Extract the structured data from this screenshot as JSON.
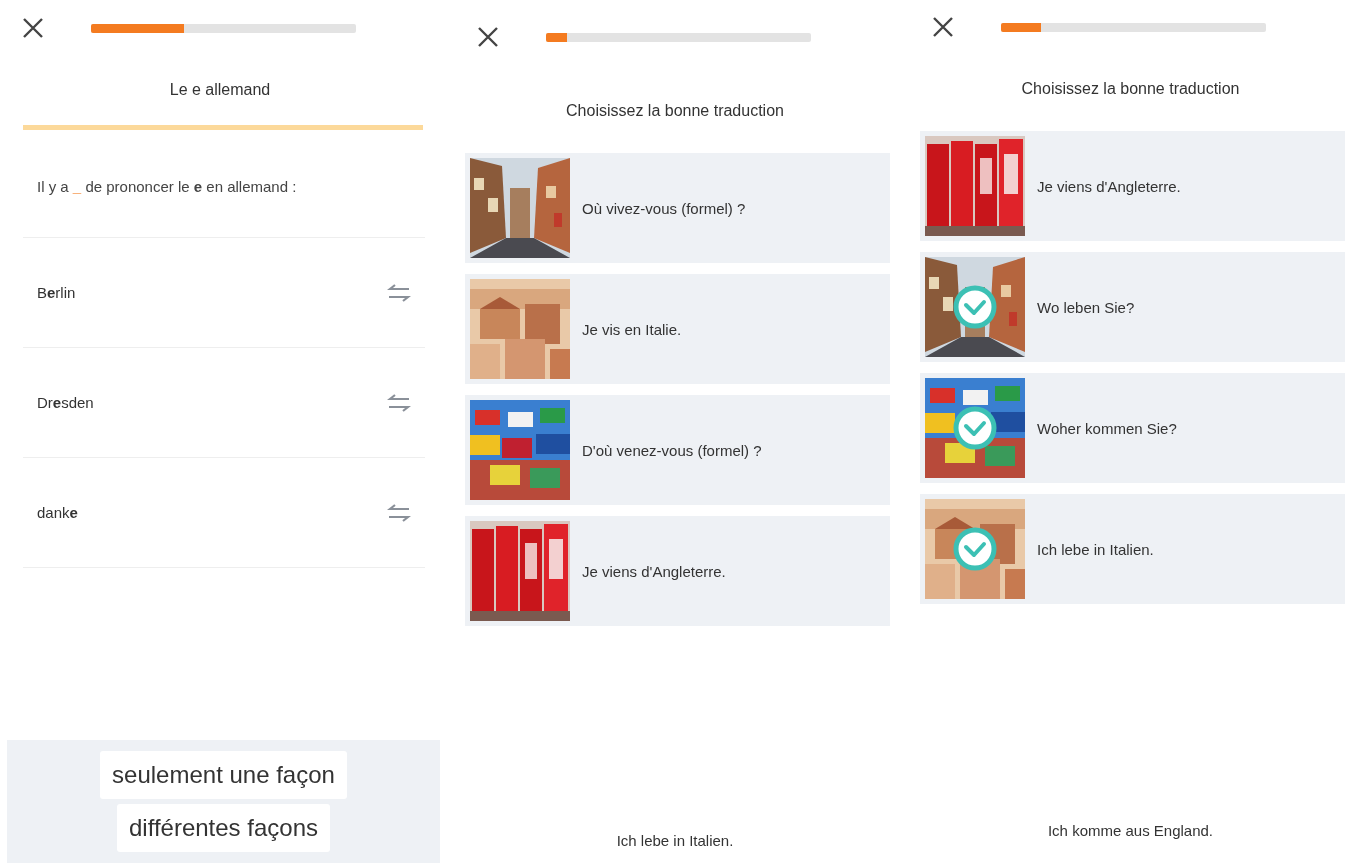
{
  "screens": [
    {
      "kind": "words",
      "progress": {
        "level": 0.35
      },
      "title": "Le e allemand",
      "prompt": {
        "before": "Il y a",
        "blank": "_",
        "after": "de prononcer le **e** en allemand :"
      },
      "words": [
        {
          "text": "B**e**rlin"
        },
        {
          "text": "Dr**e**sden"
        },
        {
          "text": "dank**e**"
        }
      ],
      "options": [
        "seulement une façon",
        "différentes façons"
      ]
    },
    {
      "kind": "cards",
      "progress": {
        "level": 0.08
      },
      "title": "Choisissez la bonne traduction",
      "cards": [
        {
          "kind": "picture",
          "text": "Où vivez-vous (formel) ?",
          "checked": false
        },
        {
          "kind": "picture",
          "text": "Je vis en Italie.",
          "checked": false
        },
        {
          "kind": "picture",
          "text": "D'où venez-vous (formel) ?",
          "checked": false
        },
        {
          "kind": "picture",
          "text": "Je viens d'Angleterre.",
          "checked": false
        }
      ],
      "footer": "Ich lebe in Italien."
    },
    {
      "kind": "cards",
      "progress": {
        "level": 0.15
      },
      "title": "Choisissez la bonne traduction",
      "cards": [
        {
          "kind": "picture",
          "text": "Je viens d'Angleterre.",
          "checked": false
        },
        {
          "kind": "picture",
          "text": "Wo leben Sie?",
          "checked": true
        },
        {
          "kind": "picture",
          "text": "Woher kommen Sie?",
          "checked": true
        },
        {
          "kind": "picture",
          "text": "Ich lebe in Italien.",
          "checked": true
        }
      ],
      "footer": "Ich komme aus England."
    }
  ]
}
